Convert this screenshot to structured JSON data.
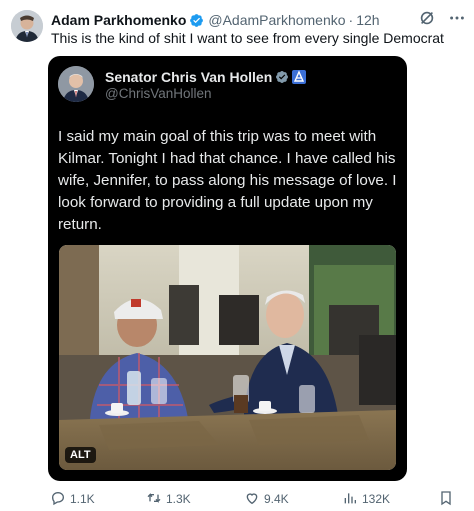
{
  "post": {
    "author_name": "Adam Parkhomenko",
    "author_handle": "@AdamParkhomenko",
    "separator": "·",
    "time": "12h",
    "text": "This is the kind of shit I want to see from every single Democrat"
  },
  "quote": {
    "author_name": "Senator Chris Van Hollen",
    "author_handle": "@ChrisVanHollen",
    "text": "I said my main goal of this trip was to meet with Kilmar. Tonight I had that chance. I have called his wife, Jennifer, to pass along his message of love. I look forward to providing a full update upon my return.",
    "image_alt_badge": "ALT"
  },
  "actions": {
    "replies": "1.1K",
    "reposts": "1.3K",
    "likes": "9.4K",
    "views": "132K"
  },
  "icons": [
    "grok-icon",
    "more-icon",
    "verified-badge-icon",
    "government-badge-icon",
    "reply-icon",
    "repost-icon",
    "like-icon",
    "views-icon",
    "bookmark-icon"
  ],
  "colors": {
    "verified": "#1d9bf0",
    "secondary_text": "#536471",
    "quote_bg": "#000000"
  }
}
